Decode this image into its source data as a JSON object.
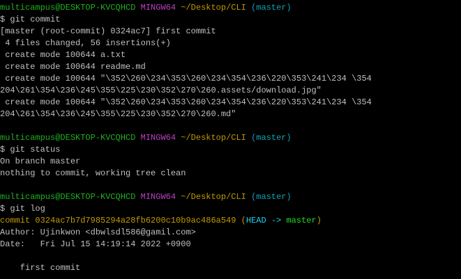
{
  "colors": {
    "user": "#1fb01f",
    "system": "#b940c0",
    "path": "#c09a00",
    "branch": "#11a3b5",
    "text": "#c0c0c0",
    "head": "#1ed0f0",
    "master": "#1fe01f"
  },
  "lines": [
    [
      {
        "t": "multicampus@DESKTOP-KVCQHCD",
        "c": "user"
      },
      {
        "t": " ",
        "c": "default"
      },
      {
        "t": "MINGW64",
        "c": "sys"
      },
      {
        "t": " ",
        "c": "default"
      },
      {
        "t": "~/Desktop/CLI",
        "c": "path"
      },
      {
        "t": " ",
        "c": "default"
      },
      {
        "t": "(master)",
        "c": "branch"
      }
    ],
    [
      {
        "t": "$ git commit",
        "c": "default"
      }
    ],
    [
      {
        "t": "[master (root-commit) 0324ac7] first commit",
        "c": "default"
      }
    ],
    [
      {
        "t": " 4 files changed, 56 insertions(+)",
        "c": "default"
      }
    ],
    [
      {
        "t": " create mode 100644 a.txt",
        "c": "default"
      }
    ],
    [
      {
        "t": " create mode 100644 readme.md",
        "c": "default"
      }
    ],
    [
      {
        "t": " create mode 100644 \"\\352\\260\\234\\353\\260\\234\\354\\236\\220\\353\\241\\234 \\354",
        "c": "default"
      }
    ],
    [
      {
        "t": "204\\261\\354\\236\\245\\355\\225\\230\\352\\270\\260.assets/download.jpg\"",
        "c": "default"
      }
    ],
    [
      {
        "t": " create mode 100644 \"\\352\\260\\234\\353\\260\\234\\354\\236\\220\\353\\241\\234 \\354",
        "c": "default"
      }
    ],
    [
      {
        "t": "204\\261\\354\\236\\245\\355\\225\\230\\352\\270\\260.md\"",
        "c": "default"
      }
    ],
    [],
    [
      {
        "t": "multicampus@DESKTOP-KVCQHCD",
        "c": "user"
      },
      {
        "t": " ",
        "c": "default"
      },
      {
        "t": "MINGW64",
        "c": "sys"
      },
      {
        "t": " ",
        "c": "default"
      },
      {
        "t": "~/Desktop/CLI",
        "c": "path"
      },
      {
        "t": " ",
        "c": "default"
      },
      {
        "t": "(master)",
        "c": "branch"
      }
    ],
    [
      {
        "t": "$ git status",
        "c": "default"
      }
    ],
    [
      {
        "t": "On branch master",
        "c": "default"
      }
    ],
    [
      {
        "t": "nothing to commit, working tree clean",
        "c": "default"
      }
    ],
    [],
    [
      {
        "t": "multicampus@DESKTOP-KVCQHCD",
        "c": "user"
      },
      {
        "t": " ",
        "c": "default"
      },
      {
        "t": "MINGW64",
        "c": "sys"
      },
      {
        "t": " ",
        "c": "default"
      },
      {
        "t": "~/Desktop/CLI",
        "c": "path"
      },
      {
        "t": " ",
        "c": "default"
      },
      {
        "t": "(master)",
        "c": "branch"
      }
    ],
    [
      {
        "t": "$ git log",
        "c": "default"
      }
    ],
    [
      {
        "t": "commit 0324ac7b7d7985294a28fb6200c10b9ac486a549 (",
        "c": "commit"
      },
      {
        "t": "HEAD -> ",
        "c": "head"
      },
      {
        "t": "master",
        "c": "master"
      },
      {
        "t": ")",
        "c": "commit"
      }
    ],
    [
      {
        "t": "Author: Ujinkwon <dbwlsdl586@gamil.com>",
        "c": "default"
      }
    ],
    [
      {
        "t": "Date:   Fri Jul 15 14:19:14 2022 +0900",
        "c": "default"
      }
    ],
    [],
    [
      {
        "t": "    first commit",
        "c": "default"
      }
    ]
  ]
}
